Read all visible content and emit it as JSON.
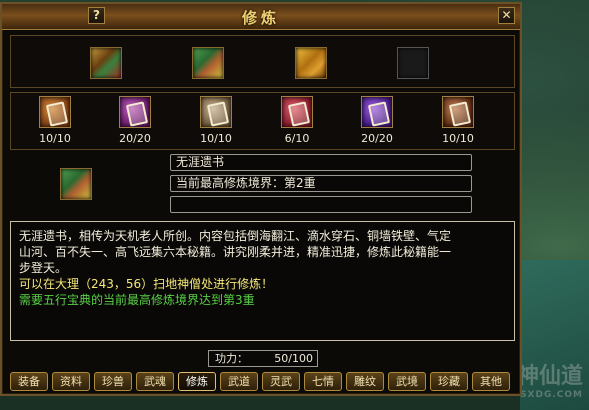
{
  "window": {
    "title": "修炼",
    "help_label": "?",
    "close_label": "✕"
  },
  "top_books": [
    {
      "icon": "book-icon",
      "empty": false
    },
    {
      "icon": "book-icon",
      "empty": false
    },
    {
      "icon": "book-icon",
      "empty": false
    },
    {
      "icon": "empty-slot-icon",
      "empty": true
    }
  ],
  "scrolls": [
    {
      "icon": "scroll-icon",
      "count": "10/10"
    },
    {
      "icon": "scroll-icon",
      "count": "20/20"
    },
    {
      "icon": "scroll-icon",
      "count": "10/10"
    },
    {
      "icon": "scroll-icon",
      "count": "6/10"
    },
    {
      "icon": "scroll-icon",
      "count": "20/20"
    },
    {
      "icon": "scroll-icon",
      "count": "10/10"
    }
  ],
  "info": {
    "book_name": "无涯遗书",
    "realm": "当前最高修炼境界：第2重",
    "extra": ""
  },
  "description": {
    "line1": "无涯遗书，相传为天机老人所创。内容包括倒海翻江、滴水穿石、铜墙铁壁、气定",
    "line2": "山河、百不失一、高飞远集六本秘籍。讲究刚柔并进，精准迅捷，修炼此秘籍能一",
    "line3": "步登天。",
    "location": "可以在大理（243，56）扫地神僧处进行修炼！",
    "requirement": "需要五行宝典的当前最高修炼境界达到第3重"
  },
  "power": {
    "label": "功力：",
    "value": "50/100"
  },
  "tabs": [
    {
      "label": "装备",
      "active": false
    },
    {
      "label": "资料",
      "active": false
    },
    {
      "label": "珍兽",
      "active": false
    },
    {
      "label": "武魂",
      "active": false
    },
    {
      "label": "修炼",
      "active": true
    },
    {
      "label": "武道",
      "active": false
    },
    {
      "label": "灵武",
      "active": false
    },
    {
      "label": "七情",
      "active": false
    },
    {
      "label": "雕纹",
      "active": false
    },
    {
      "label": "武境",
      "active": false
    },
    {
      "label": "珍藏",
      "active": false
    },
    {
      "label": "其他",
      "active": false
    }
  ],
  "watermark": {
    "text": "神仙道",
    "sub": "SXDG.COM"
  }
}
